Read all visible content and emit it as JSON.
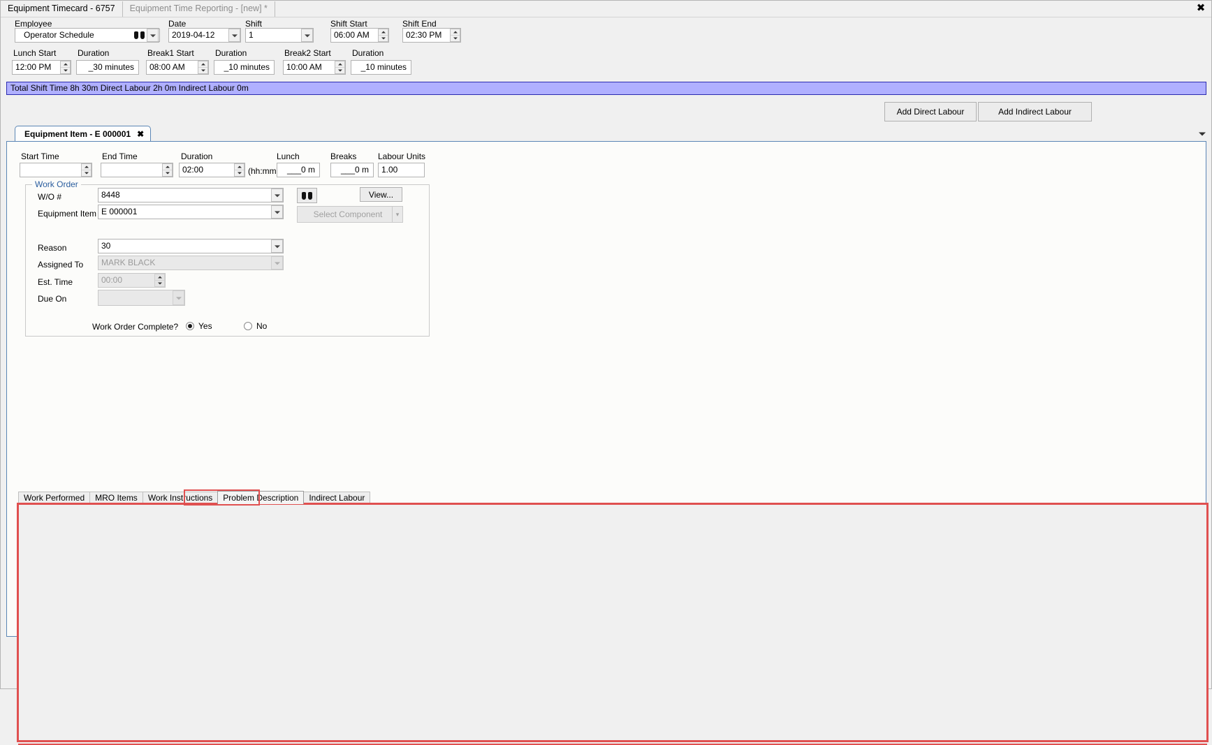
{
  "window": {
    "tabs": [
      {
        "label": "Equipment Timecard - 6757",
        "active": true
      },
      {
        "label": "Equipment Time Reporting - [new] *",
        "active": false
      }
    ],
    "close_icon": "✖"
  },
  "header": {
    "employee": {
      "label": "Employee",
      "value": "Operator Schedule",
      "ellipsis_label": "..."
    },
    "date": {
      "label": "Date",
      "value": "2019-04-12"
    },
    "shift": {
      "label": "Shift",
      "value": "1"
    },
    "shift_start": {
      "label": "Shift Start",
      "value": "06:00 AM"
    },
    "shift_end": {
      "label": "Shift End",
      "value": "02:30 PM"
    },
    "lunch_start": {
      "label": "Lunch Start",
      "value": "12:00 PM"
    },
    "lunch_duration": {
      "label": "Duration",
      "value": "_30 minutes"
    },
    "break1_start": {
      "label": "Break1 Start",
      "value": "08:00 AM"
    },
    "break1_duration": {
      "label": "Duration",
      "value": "_10 minutes"
    },
    "break2_start": {
      "label": "Break2 Start",
      "value": "10:00 AM"
    },
    "break2_duration": {
      "label": "Duration",
      "value": "_10 minutes"
    }
  },
  "summary": {
    "text": "Total Shift Time 8h 30m  Direct Labour 2h 0m  Indirect Labour 0m"
  },
  "actions": {
    "add_direct_labour": "Add Direct Labour",
    "add_indirect_labour": "Add Indirect Labour"
  },
  "item_tab": {
    "label": "Equipment Item - E 000001",
    "close_icon": "✖"
  },
  "item": {
    "start_time": {
      "label": "Start Time",
      "value": ""
    },
    "end_time": {
      "label": "End Time",
      "value": ""
    },
    "duration": {
      "label": "Duration",
      "value": "02:00",
      "hint": "(hh:mm)"
    },
    "lunch": {
      "label": "Lunch",
      "value": "___0 m"
    },
    "breaks": {
      "label": "Breaks",
      "value": "___0 m"
    },
    "labour_units": {
      "label": "Labour Units",
      "value": "1.00"
    }
  },
  "work_order": {
    "group_label": "Work Order",
    "wo_number": {
      "label": "W/O #",
      "value": "8448"
    },
    "find_icon": "binoculars-icon",
    "view_button": "View...",
    "equipment_item": {
      "label": "Equipment Item",
      "value": "E 000001"
    },
    "select_component": {
      "label": "Select Component"
    },
    "reason": {
      "label": "Reason",
      "value": "30"
    },
    "assigned_to": {
      "label": "Assigned To",
      "value": "MARK BLACK"
    },
    "est_time": {
      "label": "Est. Time",
      "value": "00:00"
    },
    "due_on": {
      "label": "Due On",
      "value": ""
    },
    "complete": {
      "label": "Work Order Complete?",
      "yes_label": "Yes",
      "no_label": "No",
      "selected": "Yes"
    }
  },
  "bottom_tabs": {
    "items": [
      {
        "label": "Work Performed",
        "selected": false
      },
      {
        "label": "MRO Items",
        "selected": false
      },
      {
        "label": "Work Instructions",
        "selected": false
      },
      {
        "label": "Problem Description",
        "selected": true
      },
      {
        "label": "Indirect Labour",
        "selected": false
      }
    ],
    "panel_content": ""
  },
  "colors": {
    "summary_bg": "#b0b0ff",
    "summary_border": "#2b2bb0",
    "highlight": "#e05050",
    "tab_border": "#5b86b5",
    "group_label": "#2a5d9e"
  }
}
